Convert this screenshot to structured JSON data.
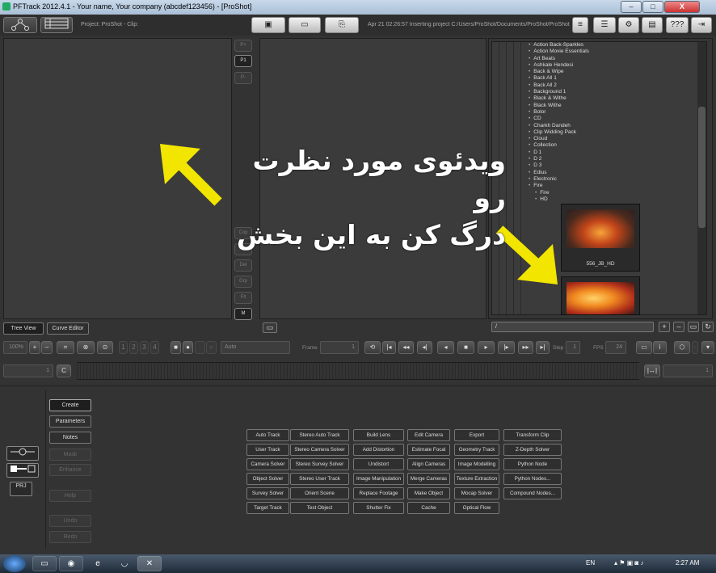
{
  "window": {
    "title": "PFTrack 2012.4.1 - Your name, Your company (abcdef123456) - [ProShot]",
    "min": "–",
    "max": "□",
    "close": "X"
  },
  "appbar": {
    "project_label": "Project: ProShot - Clip:",
    "log": "Apr 21 02:26:57 Inserting project C:/Users/ProShot/Documents/ProShot/ProShot.pfm ...",
    "help": "???"
  },
  "viewer_side": {
    "p_plus": "P+",
    "p1": "P1",
    "p_minus": "P-",
    "lower": [
      "Cop",
      "Pas",
      "Del",
      "Grp",
      "Flt"
    ],
    "m": "M"
  },
  "tree": {
    "items": [
      "Action Back-Sparkles",
      "Action Movie Essentials",
      "Art Beats",
      "Ashkale Hendesi",
      "Back & Wipe",
      "Back All 1",
      "Back All 2",
      "Background 1",
      "Black & Withe",
      "Black Withe",
      "Bolor",
      "CD",
      "Charkh Dandeh",
      "Clip Widding Pack",
      "Cloud",
      "Collection",
      "D 1",
      "D 2",
      "D 3",
      "Edius",
      "Electronic",
      "Fire"
    ],
    "sub_items": [
      "Fire",
      "HD"
    ],
    "clips": [
      {
        "name": "556_JB_HD"
      },
      {
        "name": ""
      }
    ],
    "path": "/"
  },
  "tabs": {
    "tree_view": "Tree View",
    "curve_editor": "Curve Editor"
  },
  "controls": {
    "zoom": "100%",
    "plus": "+",
    "minus": "–",
    "pages": [
      "1",
      "2",
      "3",
      "4"
    ],
    "mode": "Auto",
    "frame_label": "Frame",
    "frame_value": "1",
    "step_label": "Step",
    "step_value": "1",
    "fps_label": "FPS",
    "fps_value": "24",
    "info": "i"
  },
  "timeline": {
    "start": "1",
    "end": "1",
    "c": "C"
  },
  "side_buttons": [
    "Create",
    "Parameters",
    "Notes",
    "Mask",
    "Enhance",
    "Help",
    "Undo",
    "Redo"
  ],
  "prj": "PRJ",
  "nodes": [
    [
      "Auto Track",
      "Stereo Auto Track",
      "Build Lens",
      "Edit Camera",
      "Export",
      "Transform Clip"
    ],
    [
      "User Track",
      "Stereo Camera Solver",
      "Add Distortion",
      "Estimate Focal",
      "Geometry Track",
      "Z-Depth Solver"
    ],
    [
      "Camera Solver",
      "Stereo Survey Solver",
      "Undistort",
      "Align Cameras",
      "Image Modelling",
      "Python Node"
    ],
    [
      "Object Solver",
      "Stereo User Track",
      "Image Manipulation",
      "Merge Cameras",
      "Texture Extraction",
      "Python Nodes..."
    ],
    [
      "Survey Solver",
      "Orient Scene",
      "Replace Footage",
      "Make Object",
      "Mocap Solver",
      "Compound Nodes..."
    ],
    [
      "Target Track",
      "Test Object",
      "Shutter Fix",
      "Cache",
      "Optical Flow"
    ]
  ],
  "annotation": {
    "line1": "ویدئوی مورد نظرت رو",
    "line2": "درگ کن به این بخش",
    "color": "#f2e600"
  },
  "taskbar": {
    "lang": "EN",
    "time": "2:27 AM"
  }
}
